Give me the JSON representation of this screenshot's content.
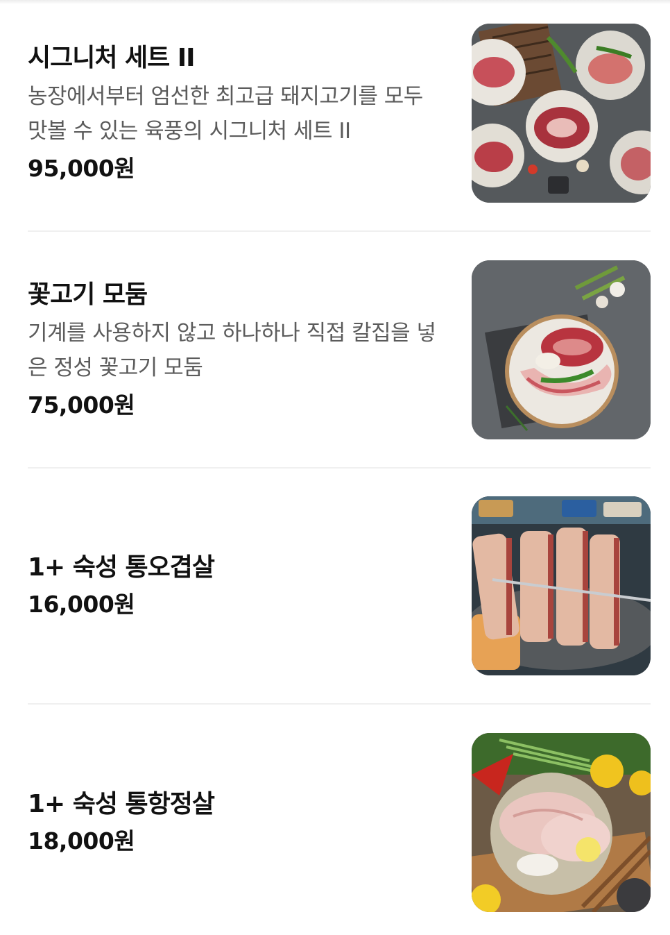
{
  "menu": {
    "items": [
      {
        "name": "시그니처 세트 II",
        "description": "농장에서부터 엄선한 최고급 돼지고기를 모두 맛볼 수 있는 육풍의 시그니처 세트 II",
        "price": "95,000원",
        "image_icon": "meat-platter-photo"
      },
      {
        "name": "꽃고기 모둠",
        "description": "기계를 사용하지 않고 하나하나 직접 칼집을 넣은 정성 꽃고기 모둠",
        "price": "75,000원",
        "image_icon": "pork-plate-photo"
      },
      {
        "name": "1+ 숙성 통오겹살",
        "description": "",
        "price": "16,000원",
        "image_icon": "grilled-pork-belly-photo"
      },
      {
        "name": "1+ 숙성 통항정살",
        "description": "",
        "price": "18,000원",
        "image_icon": "pork-jowl-photo"
      }
    ]
  },
  "colors": {
    "title": "#111111",
    "description": "#5b5b5b",
    "divider": "#f0f0f0",
    "background": "#ffffff"
  }
}
